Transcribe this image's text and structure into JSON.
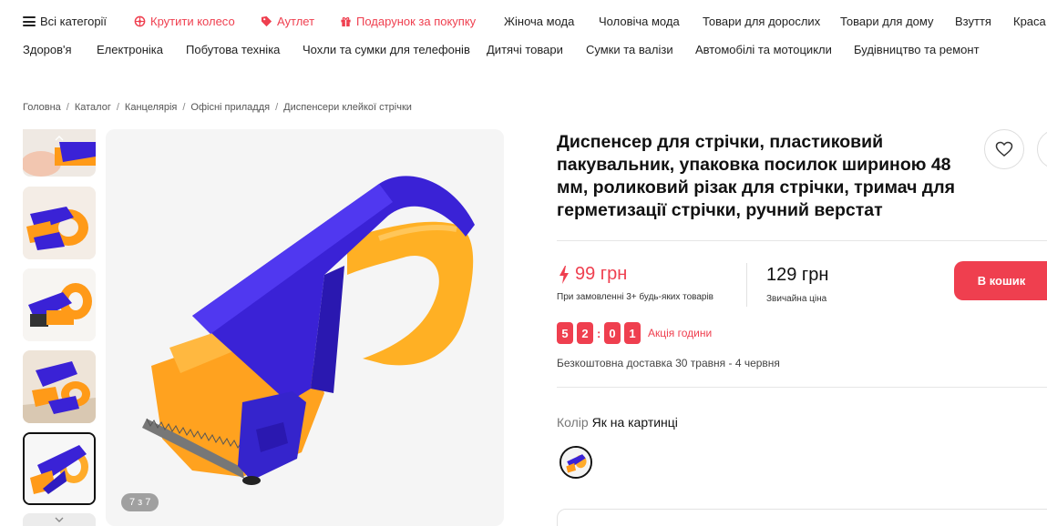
{
  "nav": {
    "row1": [
      {
        "id": "all",
        "label": "Всі категорії",
        "icon": "hamburger-icon"
      },
      {
        "id": "wheel",
        "label": "Крутити колесо",
        "icon": "wheel-icon"
      },
      {
        "id": "outlet",
        "label": "Аутлет",
        "icon": "tag-icon"
      },
      {
        "id": "gift",
        "label": "Подарунок за покупку",
        "icon": "gift-icon"
      },
      {
        "id": "women",
        "label": "Жіноча мода"
      },
      {
        "id": "men",
        "label": "Чоловіча мода"
      },
      {
        "id": "adult",
        "label": "Товари для дорослих"
      },
      {
        "id": "home",
        "label": "Товари для дому"
      },
      {
        "id": "shoes",
        "label": "Взуття"
      },
      {
        "id": "beauty",
        "label": "Краса"
      }
    ],
    "row2": [
      {
        "id": "health",
        "label": "Здоров'я"
      },
      {
        "id": "electronics",
        "label": "Електроніка"
      },
      {
        "id": "appliances",
        "label": "Побутова техніка"
      },
      {
        "id": "cases",
        "label": "Чохли та сумки для телефонів"
      },
      {
        "id": "kids",
        "label": "Дитячі товари"
      },
      {
        "id": "bags",
        "label": "Сумки та валізи"
      },
      {
        "id": "auto",
        "label": "Автомобілі та мотоцикли"
      },
      {
        "id": "construction",
        "label": "Будівництво та ремонт"
      }
    ]
  },
  "breadcrumb": [
    "Головна",
    "Каталог",
    "Канцелярія",
    "Офісні приладдя",
    "Диспенсери клейкої стрічки"
  ],
  "gallery": {
    "counter": "7 з 7",
    "active_index": 4
  },
  "product": {
    "title": "Диспенсер для стрічки, пластиковий пакувальник, упаковка посилок шириною 48 мм, роликовий різак для стрічки, тримач для герметизації стрічки, ручний верстат",
    "promo_price": "99 грн",
    "promo_note": "При замовленні 3+ будь-яких товарів",
    "regular_price": "129 грн",
    "regular_note": "Звичайна ціна",
    "cart_label": "В кошик",
    "timer_digits": [
      "5",
      "2",
      "0",
      "1"
    ],
    "timer_label": "Акція години",
    "delivery": "Безкоштовна доставка 30 травня - 4 червня",
    "color_key": "Колір",
    "color_value": "Як на картинці"
  },
  "colors": {
    "accent": "#ef3f4f",
    "dispenser_body": "#3a22d6",
    "dispenser_roll": "#ffa21f"
  }
}
